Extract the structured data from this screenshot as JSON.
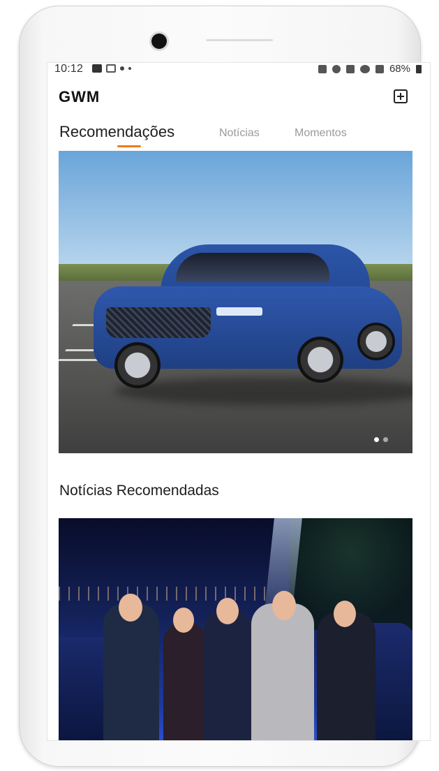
{
  "status_bar": {
    "time": "10:12",
    "battery": "68%"
  },
  "header": {
    "logo": "GWM"
  },
  "tabs": [
    {
      "label": "Recomendações",
      "active": true
    },
    {
      "label": "Notícias",
      "active": false
    },
    {
      "label": "Momentos",
      "active": false
    }
  ],
  "carousel": {
    "current_page": 1,
    "page_count": 2
  },
  "section": {
    "title": "Notícias Recomendadas"
  },
  "colors": {
    "accent": "#f07a1a",
    "text": "#1d1d1d",
    "tab_inactive": "#9a9a9a"
  }
}
